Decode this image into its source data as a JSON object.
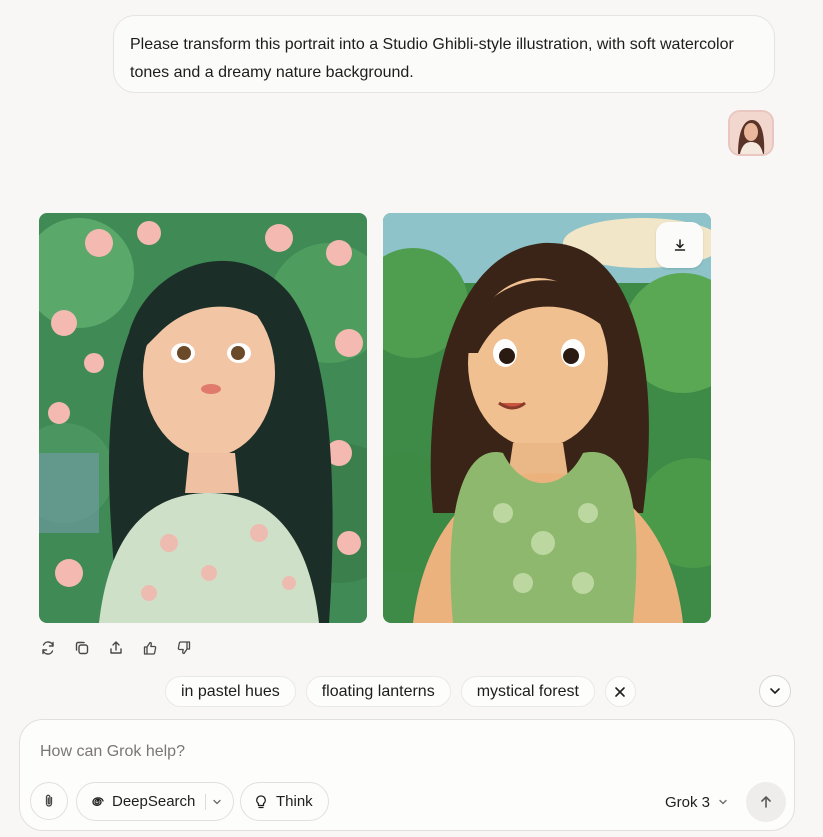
{
  "message": {
    "text": "Please transform this portrait into a Studio Ghibli-style illustration, with soft watercolor tones and a dreamy nature background."
  },
  "suggestions": [
    "in pastel hues",
    "floating lanterns",
    "mystical forest"
  ],
  "composer": {
    "placeholder": "How can Grok help?",
    "deepsearch_label": "DeepSearch",
    "think_label": "Think",
    "model_label": "Grok 3"
  },
  "icons": {
    "regenerate": "refresh-icon",
    "copy": "copy-icon",
    "share": "share-icon",
    "like": "thumbs-up-icon",
    "dislike": "thumbs-down-icon",
    "download": "download-icon",
    "attach": "paperclip-icon",
    "deepsearch": "swirl-icon",
    "think": "lightbulb-icon",
    "send": "arrow-up-icon"
  },
  "colors": {
    "background": "#f8f7f6",
    "bubble": "#fbfbfa",
    "border": "#e2e0dd"
  }
}
